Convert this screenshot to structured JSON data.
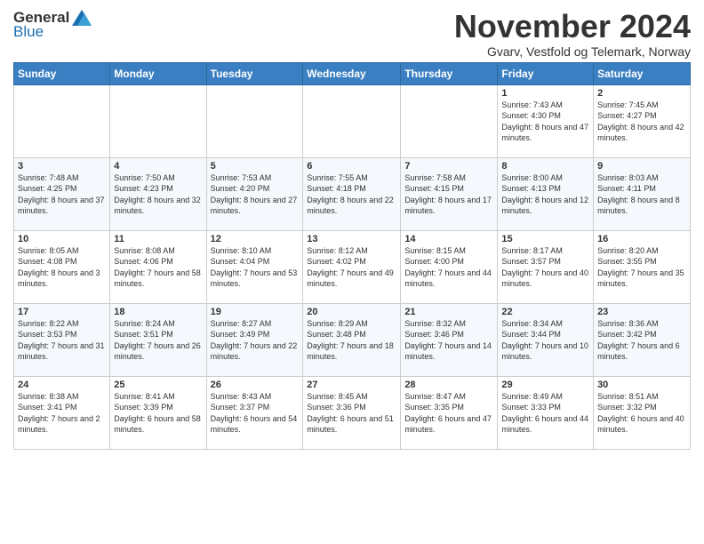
{
  "header": {
    "logo_general": "General",
    "logo_blue": "Blue",
    "month_title": "November 2024",
    "subtitle": "Gvarv, Vestfold og Telemark, Norway"
  },
  "weekdays": [
    "Sunday",
    "Monday",
    "Tuesday",
    "Wednesday",
    "Thursday",
    "Friday",
    "Saturday"
  ],
  "weeks": [
    [
      {
        "day": "",
        "sunrise": "",
        "sunset": "",
        "daylight": ""
      },
      {
        "day": "",
        "sunrise": "",
        "sunset": "",
        "daylight": ""
      },
      {
        "day": "",
        "sunrise": "",
        "sunset": "",
        "daylight": ""
      },
      {
        "day": "",
        "sunrise": "",
        "sunset": "",
        "daylight": ""
      },
      {
        "day": "",
        "sunrise": "",
        "sunset": "",
        "daylight": ""
      },
      {
        "day": "1",
        "sunrise": "Sunrise: 7:43 AM",
        "sunset": "Sunset: 4:30 PM",
        "daylight": "Daylight: 8 hours and 47 minutes."
      },
      {
        "day": "2",
        "sunrise": "Sunrise: 7:45 AM",
        "sunset": "Sunset: 4:27 PM",
        "daylight": "Daylight: 8 hours and 42 minutes."
      }
    ],
    [
      {
        "day": "3",
        "sunrise": "Sunrise: 7:48 AM",
        "sunset": "Sunset: 4:25 PM",
        "daylight": "Daylight: 8 hours and 37 minutes."
      },
      {
        "day": "4",
        "sunrise": "Sunrise: 7:50 AM",
        "sunset": "Sunset: 4:23 PM",
        "daylight": "Daylight: 8 hours and 32 minutes."
      },
      {
        "day": "5",
        "sunrise": "Sunrise: 7:53 AM",
        "sunset": "Sunset: 4:20 PM",
        "daylight": "Daylight: 8 hours and 27 minutes."
      },
      {
        "day": "6",
        "sunrise": "Sunrise: 7:55 AM",
        "sunset": "Sunset: 4:18 PM",
        "daylight": "Daylight: 8 hours and 22 minutes."
      },
      {
        "day": "7",
        "sunrise": "Sunrise: 7:58 AM",
        "sunset": "Sunset: 4:15 PM",
        "daylight": "Daylight: 8 hours and 17 minutes."
      },
      {
        "day": "8",
        "sunrise": "Sunrise: 8:00 AM",
        "sunset": "Sunset: 4:13 PM",
        "daylight": "Daylight: 8 hours and 12 minutes."
      },
      {
        "day": "9",
        "sunrise": "Sunrise: 8:03 AM",
        "sunset": "Sunset: 4:11 PM",
        "daylight": "Daylight: 8 hours and 8 minutes."
      }
    ],
    [
      {
        "day": "10",
        "sunrise": "Sunrise: 8:05 AM",
        "sunset": "Sunset: 4:08 PM",
        "daylight": "Daylight: 8 hours and 3 minutes."
      },
      {
        "day": "11",
        "sunrise": "Sunrise: 8:08 AM",
        "sunset": "Sunset: 4:06 PM",
        "daylight": "Daylight: 7 hours and 58 minutes."
      },
      {
        "day": "12",
        "sunrise": "Sunrise: 8:10 AM",
        "sunset": "Sunset: 4:04 PM",
        "daylight": "Daylight: 7 hours and 53 minutes."
      },
      {
        "day": "13",
        "sunrise": "Sunrise: 8:12 AM",
        "sunset": "Sunset: 4:02 PM",
        "daylight": "Daylight: 7 hours and 49 minutes."
      },
      {
        "day": "14",
        "sunrise": "Sunrise: 8:15 AM",
        "sunset": "Sunset: 4:00 PM",
        "daylight": "Daylight: 7 hours and 44 minutes."
      },
      {
        "day": "15",
        "sunrise": "Sunrise: 8:17 AM",
        "sunset": "Sunset: 3:57 PM",
        "daylight": "Daylight: 7 hours and 40 minutes."
      },
      {
        "day": "16",
        "sunrise": "Sunrise: 8:20 AM",
        "sunset": "Sunset: 3:55 PM",
        "daylight": "Daylight: 7 hours and 35 minutes."
      }
    ],
    [
      {
        "day": "17",
        "sunrise": "Sunrise: 8:22 AM",
        "sunset": "Sunset: 3:53 PM",
        "daylight": "Daylight: 7 hours and 31 minutes."
      },
      {
        "day": "18",
        "sunrise": "Sunrise: 8:24 AM",
        "sunset": "Sunset: 3:51 PM",
        "daylight": "Daylight: 7 hours and 26 minutes."
      },
      {
        "day": "19",
        "sunrise": "Sunrise: 8:27 AM",
        "sunset": "Sunset: 3:49 PM",
        "daylight": "Daylight: 7 hours and 22 minutes."
      },
      {
        "day": "20",
        "sunrise": "Sunrise: 8:29 AM",
        "sunset": "Sunset: 3:48 PM",
        "daylight": "Daylight: 7 hours and 18 minutes."
      },
      {
        "day": "21",
        "sunrise": "Sunrise: 8:32 AM",
        "sunset": "Sunset: 3:46 PM",
        "daylight": "Daylight: 7 hours and 14 minutes."
      },
      {
        "day": "22",
        "sunrise": "Sunrise: 8:34 AM",
        "sunset": "Sunset: 3:44 PM",
        "daylight": "Daylight: 7 hours and 10 minutes."
      },
      {
        "day": "23",
        "sunrise": "Sunrise: 8:36 AM",
        "sunset": "Sunset: 3:42 PM",
        "daylight": "Daylight: 7 hours and 6 minutes."
      }
    ],
    [
      {
        "day": "24",
        "sunrise": "Sunrise: 8:38 AM",
        "sunset": "Sunset: 3:41 PM",
        "daylight": "Daylight: 7 hours and 2 minutes."
      },
      {
        "day": "25",
        "sunrise": "Sunrise: 8:41 AM",
        "sunset": "Sunset: 3:39 PM",
        "daylight": "Daylight: 6 hours and 58 minutes."
      },
      {
        "day": "26",
        "sunrise": "Sunrise: 8:43 AM",
        "sunset": "Sunset: 3:37 PM",
        "daylight": "Daylight: 6 hours and 54 minutes."
      },
      {
        "day": "27",
        "sunrise": "Sunrise: 8:45 AM",
        "sunset": "Sunset: 3:36 PM",
        "daylight": "Daylight: 6 hours and 51 minutes."
      },
      {
        "day": "28",
        "sunrise": "Sunrise: 8:47 AM",
        "sunset": "Sunset: 3:35 PM",
        "daylight": "Daylight: 6 hours and 47 minutes."
      },
      {
        "day": "29",
        "sunrise": "Sunrise: 8:49 AM",
        "sunset": "Sunset: 3:33 PM",
        "daylight": "Daylight: 6 hours and 44 minutes."
      },
      {
        "day": "30",
        "sunrise": "Sunrise: 8:51 AM",
        "sunset": "Sunset: 3:32 PM",
        "daylight": "Daylight: 6 hours and 40 minutes."
      }
    ]
  ]
}
